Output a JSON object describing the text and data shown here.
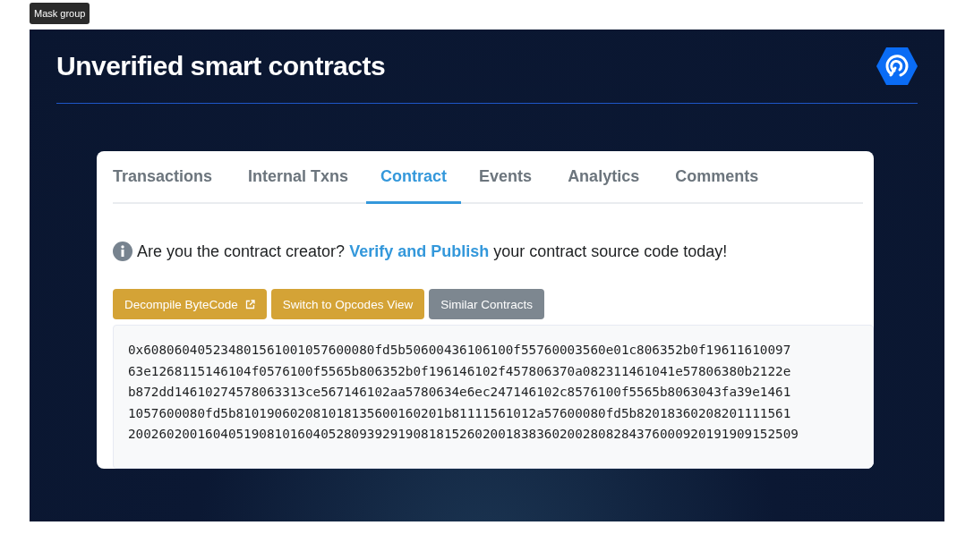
{
  "tooltip": "Mask group",
  "slide": {
    "title": "Unverified smart contracts"
  },
  "tabs": [
    {
      "label": "Transactions",
      "selected": false
    },
    {
      "label": "Internal Txns",
      "selected": false
    },
    {
      "label": "Contract",
      "selected": true
    },
    {
      "label": "Events",
      "selected": false
    },
    {
      "label": "Analytics",
      "selected": false
    },
    {
      "label": "Comments",
      "selected": false
    }
  ],
  "notice": {
    "prefix": "Are you the contract creator?",
    "link": "Verify and Publish",
    "suffix": "your contract source code today!"
  },
  "buttons": [
    {
      "label": "Decompile ByteCode",
      "kind": "warning",
      "external": true
    },
    {
      "label": "Switch to Opcodes View",
      "kind": "warning",
      "external": false
    },
    {
      "label": "Similar Contracts",
      "kind": "secondary",
      "external": false
    }
  ],
  "bytecode_lines": [
    "0x608060405234801561001057600080fd5b50600436106100f55760003560e01c806352b0f19611610097",
    "63e1268115146104f0576100f5565b806352b0f196146102f457806370a082311461041e57806380b2122e",
    "b872dd14610274578063313ce567146102aa5780634e6ec247146102c8576100f5565b8063043fa39e1461",
    "1057600080fd5b810190602081018135600160201b81111561012a57600080fd5b82018360208201111561",
    "200260200160405190810160405280939291908181526020018383602002808284376000920191909152509"
  ]
}
